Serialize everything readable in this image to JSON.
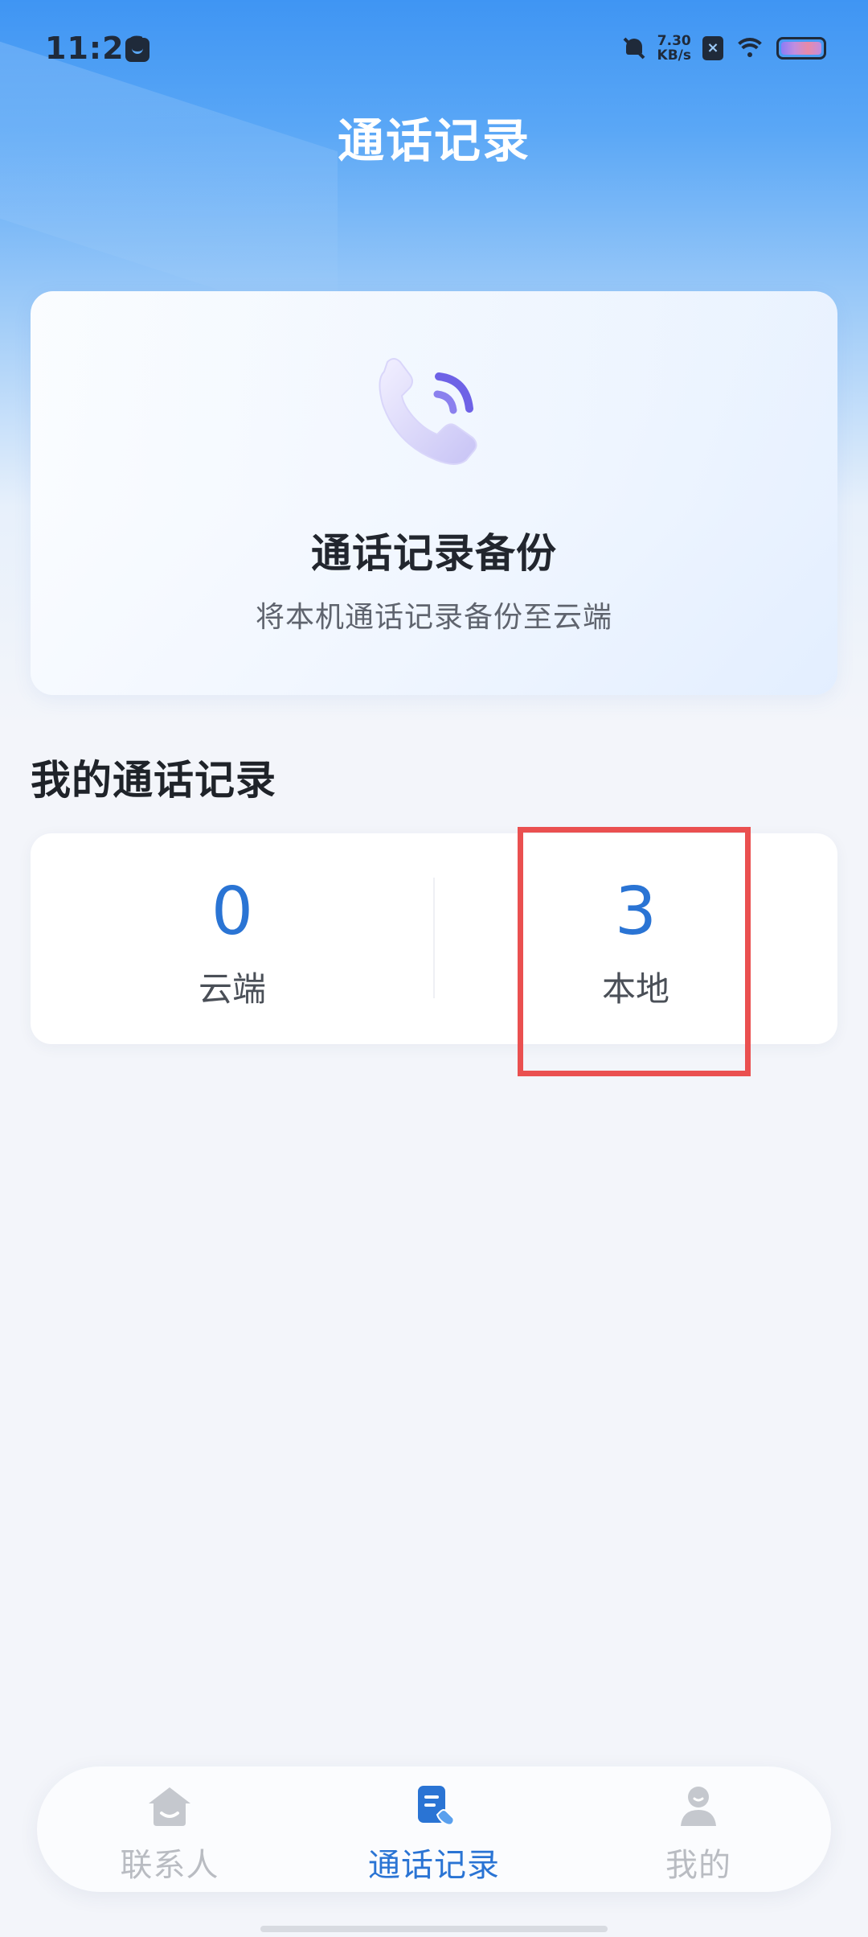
{
  "status_bar": {
    "time": "11:26",
    "net_speed_value": "7.30",
    "net_speed_unit": "KB/s",
    "sim_badge": "×"
  },
  "header": {
    "title": "通话记录"
  },
  "backup_card": {
    "title": "通话记录备份",
    "subtitle": "将本机通话记录备份至云端"
  },
  "records": {
    "section_title": "我的通话记录",
    "cloud": {
      "count": "0",
      "label": "云端"
    },
    "local": {
      "count": "3",
      "label": "本地"
    }
  },
  "tabbar": {
    "items": [
      {
        "label": "联系人",
        "icon": "contacts-home-icon",
        "active": false
      },
      {
        "label": "通话记录",
        "icon": "call-log-icon",
        "active": true
      },
      {
        "label": "我的",
        "icon": "profile-icon",
        "active": false
      }
    ]
  },
  "colors": {
    "accent": "#2a74d4",
    "header_gradient_top": "#3f95f3",
    "highlight": "#ea5050",
    "inactive_tab": "#b9bcc2"
  }
}
